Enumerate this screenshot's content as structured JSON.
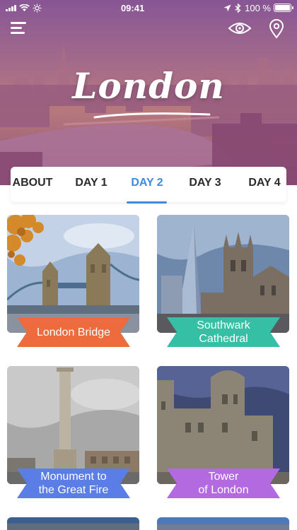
{
  "status_bar": {
    "time": "09:41",
    "battery": "100 %",
    "battery_level": 1.0
  },
  "header": {
    "title": "London",
    "menu_icon": "hamburger-menu-icon",
    "view_icon": "eye-icon",
    "location_icon": "map-pin-icon"
  },
  "tabs": [
    {
      "label": "ABOUT",
      "active": false
    },
    {
      "label": "DAY 1",
      "active": false
    },
    {
      "label": "DAY 2",
      "active": true
    },
    {
      "label": "DAY 3",
      "active": false
    },
    {
      "label": "DAY 4",
      "active": false
    }
  ],
  "colors": {
    "accent": "#3d8be0",
    "ribbon_orange": "#ee6b3e",
    "ribbon_teal": "#35c0a6",
    "ribbon_blue": "#5b7ee6",
    "ribbon_purple": "#b36ae0"
  },
  "attractions": [
    {
      "label": "London Bridge"
    },
    {
      "label": "Southwark\nCathedral"
    },
    {
      "label": "Monument to\nthe Great Fire"
    },
    {
      "label": "Tower\nof London"
    }
  ]
}
